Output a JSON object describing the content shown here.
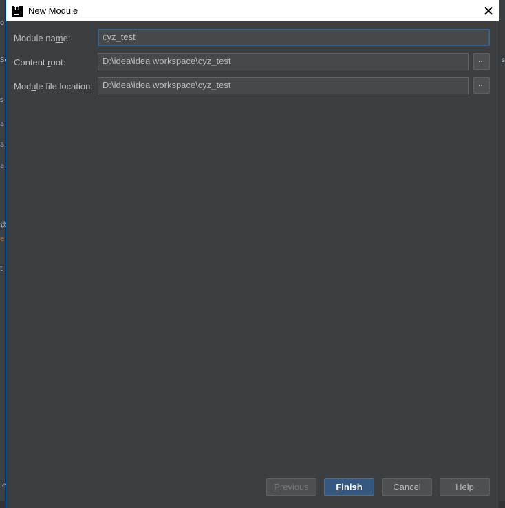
{
  "window": {
    "title": "New Module",
    "app_icon_text": "IJ",
    "close_glyph": "✕"
  },
  "form": {
    "module_name": {
      "label_pre": "Module na",
      "label_mnemonic": "m",
      "label_post": "e:",
      "value": "cyz_test"
    },
    "content_root": {
      "label_pre": "Content ",
      "label_mnemonic": "r",
      "label_post": "oot:",
      "value": "D:\\idea\\idea workspace\\cyz_test",
      "browse_label": "..."
    },
    "module_file_location": {
      "label_pre": "Mod",
      "label_mnemonic": "u",
      "label_post": "le file location:",
      "value": "D:\\idea\\idea workspace\\cyz_test",
      "browse_label": "..."
    }
  },
  "buttons": {
    "previous": {
      "mnemonic": "P",
      "rest": "revious"
    },
    "finish": {
      "mnemonic": "F",
      "rest": "inish"
    },
    "cancel": "Cancel",
    "help": "Help"
  },
  "background_marks": {
    "left": [
      "o",
      "Sc",
      "s",
      "a",
      "a",
      "a",
      "谈",
      "e",
      "t",
      "ie"
    ],
    "right": [
      "s"
    ]
  },
  "colors": {
    "dialog_bg": "#3c3f41",
    "field_bg": "#45494a",
    "focus_border": "#3d6185",
    "primary_button": "#365880",
    "title_bar": "#ffffff"
  }
}
